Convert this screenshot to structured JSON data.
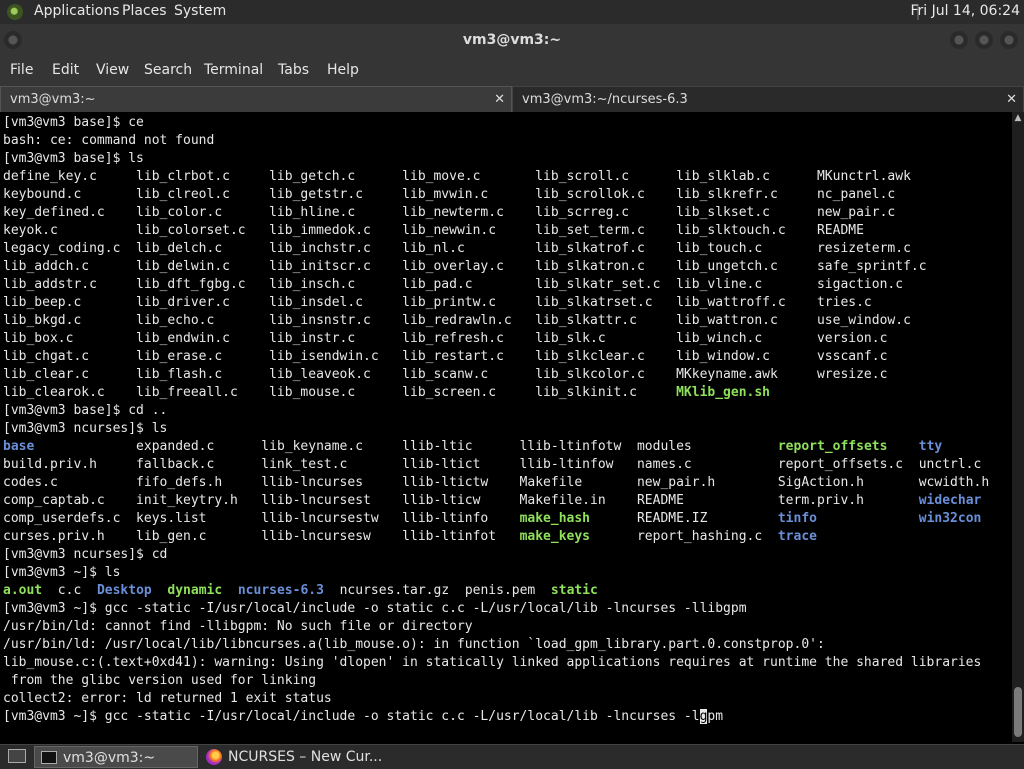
{
  "top_panel": {
    "menus": [
      "Applications",
      "Places",
      "System"
    ],
    "clock": "Fri Jul 14, 06:24"
  },
  "window": {
    "title": "vm3@vm3:~"
  },
  "menubar": [
    "File",
    "Edit",
    "View",
    "Search",
    "Terminal",
    "Tabs",
    "Help"
  ],
  "tabs": [
    {
      "label": "vm3@vm3:~",
      "close": "✕"
    },
    {
      "label": "vm3@vm3:~/ncurses-6.3",
      "close": "✕"
    }
  ],
  "terminal": {
    "l01": "[vm3@vm3 base]$ ce",
    "l02": "bash: ce: command not found",
    "l03": "[vm3@vm3 base]$ ls",
    "l04": "define_key.c     lib_clrbot.c     lib_getch.c      lib_move.c       lib_scroll.c      lib_slklab.c      MKunctrl.awk",
    "l05": "keybound.c       lib_clreol.c     lib_getstr.c     lib_mvwin.c      lib_scrollok.c    lib_slkrefr.c     nc_panel.c",
    "l06": "key_defined.c    lib_color.c      lib_hline.c      lib_newterm.c    lib_scrreg.c      lib_slkset.c      new_pair.c",
    "l07": "keyok.c          lib_colorset.c   lib_immedok.c    lib_newwin.c     lib_set_term.c    lib_slktouch.c    README",
    "l08": "legacy_coding.c  lib_delch.c      lib_inchstr.c    lib_nl.c         lib_slkatrof.c    lib_touch.c       resizeterm.c",
    "l09": "lib_addch.c      lib_delwin.c     lib_initscr.c    lib_overlay.c    lib_slkatron.c    lib_ungetch.c     safe_sprintf.c",
    "l10": "lib_addstr.c     lib_dft_fgbg.c   lib_insch.c      lib_pad.c        lib_slkatr_set.c  lib_vline.c       sigaction.c",
    "l11": "lib_beep.c       lib_driver.c     lib_insdel.c     lib_printw.c     lib_slkatrset.c   lib_wattroff.c    tries.c",
    "l12": "lib_bkgd.c       lib_echo.c       lib_insnstr.c    lib_redrawln.c   lib_slkattr.c     lib_wattron.c     use_window.c",
    "l13": "lib_box.c        lib_endwin.c     lib_instr.c      lib_refresh.c    lib_slk.c         lib_winch.c       version.c",
    "l14": "lib_chgat.c      lib_erase.c      lib_isendwin.c   lib_restart.c    lib_slkclear.c    lib_window.c      vsscanf.c",
    "l15": "lib_clear.c      lib_flash.c      lib_leaveok.c    lib_scanw.c      lib_slkcolor.c    MKkeyname.awk     wresize.c",
    "l16a": "lib_clearok.c    lib_freeall.c    lib_mouse.c      lib_screen.c     lib_slkinit.c     ",
    "l16b": "MKlib_gen.sh",
    "l17": "[vm3@vm3 base]$ cd ..",
    "l18": "[vm3@vm3 ncurses]$ ls",
    "l19": [
      {
        "t": "base",
        "c": "blue"
      },
      {
        "t": "             expanded.c      lib_keyname.c     llib-ltic      llib-ltinfotw  modules           ",
        "c": ""
      },
      {
        "t": "report_offsets",
        "c": "green"
      },
      {
        "t": "    ",
        "c": ""
      },
      {
        "t": "tty",
        "c": "blue"
      }
    ],
    "l20": "build.priv.h     fallback.c      link_test.c       llib-ltict     llib-ltinfow   names.c           report_offsets.c  unctrl.c",
    "l21": "codes.c          fifo_defs.h     llib-lncurses     llib-ltictw    Makefile       new_pair.h        SigAction.h       wcwidth.h",
    "l22": [
      {
        "t": "comp_captab.c    init_keytry.h   llib-lncursest    llib-lticw     Makefile.in    README            term.priv.h       ",
        "c": ""
      },
      {
        "t": "widechar",
        "c": "blue"
      }
    ],
    "l23": [
      {
        "t": "comp_userdefs.c  keys.list       llib-lncursestw   llib-ltinfo    ",
        "c": ""
      },
      {
        "t": "make_hash",
        "c": "green"
      },
      {
        "t": "      README.IZ         ",
        "c": ""
      },
      {
        "t": "tinfo",
        "c": "blue"
      },
      {
        "t": "             ",
        "c": ""
      },
      {
        "t": "win32con",
        "c": "blue"
      }
    ],
    "l24": [
      {
        "t": "curses.priv.h    lib_gen.c       llib-lncursesw    llib-ltinfot   ",
        "c": ""
      },
      {
        "t": "make_keys",
        "c": "green"
      },
      {
        "t": "      report_hashing.c  ",
        "c": ""
      },
      {
        "t": "trace",
        "c": "blue"
      }
    ],
    "l25": "[vm3@vm3 ncurses]$ cd",
    "l26": "[vm3@vm3 ~]$ ls",
    "l27": [
      {
        "t": "a.out",
        "c": "green"
      },
      {
        "t": "  c.c  ",
        "c": ""
      },
      {
        "t": "Desktop",
        "c": "blue"
      },
      {
        "t": "  ",
        "c": ""
      },
      {
        "t": "dynamic",
        "c": "green"
      },
      {
        "t": "  ",
        "c": ""
      },
      {
        "t": "ncurses-6.3",
        "c": "blue"
      },
      {
        "t": "  ncurses.tar.gz  penis.pem  ",
        "c": ""
      },
      {
        "t": "static",
        "c": "green"
      }
    ],
    "l28": "[vm3@vm3 ~]$ gcc -static -I/usr/local/include -o static c.c -L/usr/local/lib -lncurses -llibgpm",
    "l29": "/usr/bin/ld: cannot find -llibgpm: No such file or directory",
    "l30": "/usr/bin/ld: /usr/local/lib/libncurses.a(lib_mouse.o): in function `load_gpm_library.part.0.constprop.0':",
    "l31": "lib_mouse.c:(.text+0xd41): warning: Using 'dlopen' in statically linked applications requires at runtime the shared libraries",
    "l32": " from the glibc version used for linking",
    "l33": "collect2: error: ld returned 1 exit status",
    "l34a": "[vm3@vm3 ~]$ gcc -static -I/usr/local/include -o static c.c -L/usr/local/lib -lncurses -l",
    "l34cur": "g",
    "l34b": "pm"
  },
  "taskbar": {
    "tasks": [
      "vm3@vm3:~",
      "NCURSES – New Cur..."
    ]
  }
}
